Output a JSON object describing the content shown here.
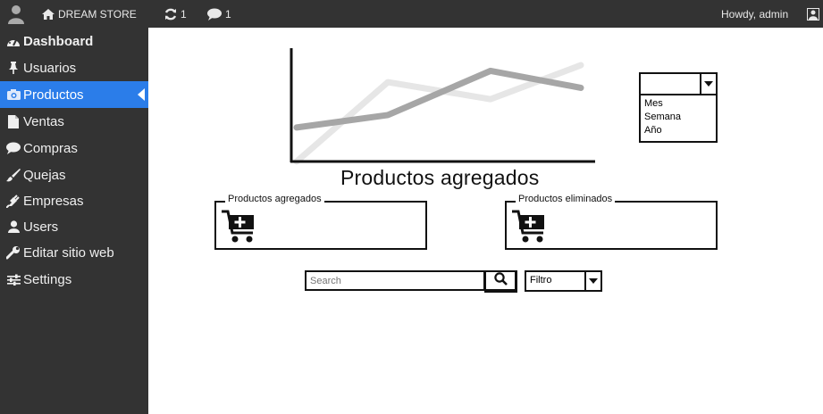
{
  "topbar": {
    "site_name": "DREAM STORE",
    "updates_count": "1",
    "comments_count": "1",
    "greeting": "Howdy, admin"
  },
  "sidebar": {
    "items": [
      {
        "label": "Dashboard",
        "icon": "dashboard-icon"
      },
      {
        "label": "Usuarios",
        "icon": "pin-icon"
      },
      {
        "label": "Productos",
        "icon": "camera-icon"
      },
      {
        "label": "Ventas",
        "icon": "document-icon"
      },
      {
        "label": "Compras",
        "icon": "speech-bubble-icon"
      },
      {
        "label": "Quejas",
        "icon": "brush-icon"
      },
      {
        "label": "Empresas",
        "icon": "plugin-icon"
      },
      {
        "label": "Users",
        "icon": "user-icon"
      },
      {
        "label": "Editar sitio web",
        "icon": "wrench-icon"
      },
      {
        "label": "Settings",
        "icon": "sliders-icon"
      }
    ],
    "active_index": 2
  },
  "chart": {
    "title": "Productos agregados",
    "period_dropdown": {
      "selected": "",
      "options": [
        "Mes",
        "Semana",
        "Año"
      ]
    }
  },
  "chart_data": {
    "type": "line",
    "title": "Productos agregados",
    "x": [
      0,
      1,
      2,
      3
    ],
    "ylim": [
      0,
      10
    ],
    "series": [
      {
        "values": [
          0,
          7,
          5.5,
          8.5
        ],
        "color": "#e6e6e6"
      },
      {
        "values": [
          3,
          4.1,
          8,
          6.5
        ],
        "color": "#a6a6a6"
      }
    ],
    "grid": false
  },
  "panels": {
    "added": {
      "label": "Productos agregados",
      "icon": "cart-add-icon"
    },
    "removed": {
      "label": "Productos eliminados",
      "icon": "cart-add-icon"
    }
  },
  "search": {
    "placeholder": "Search",
    "filter_label": "Filtro"
  },
  "colors": {
    "bar_bg": "#333333",
    "accent": "#2b7de9"
  }
}
